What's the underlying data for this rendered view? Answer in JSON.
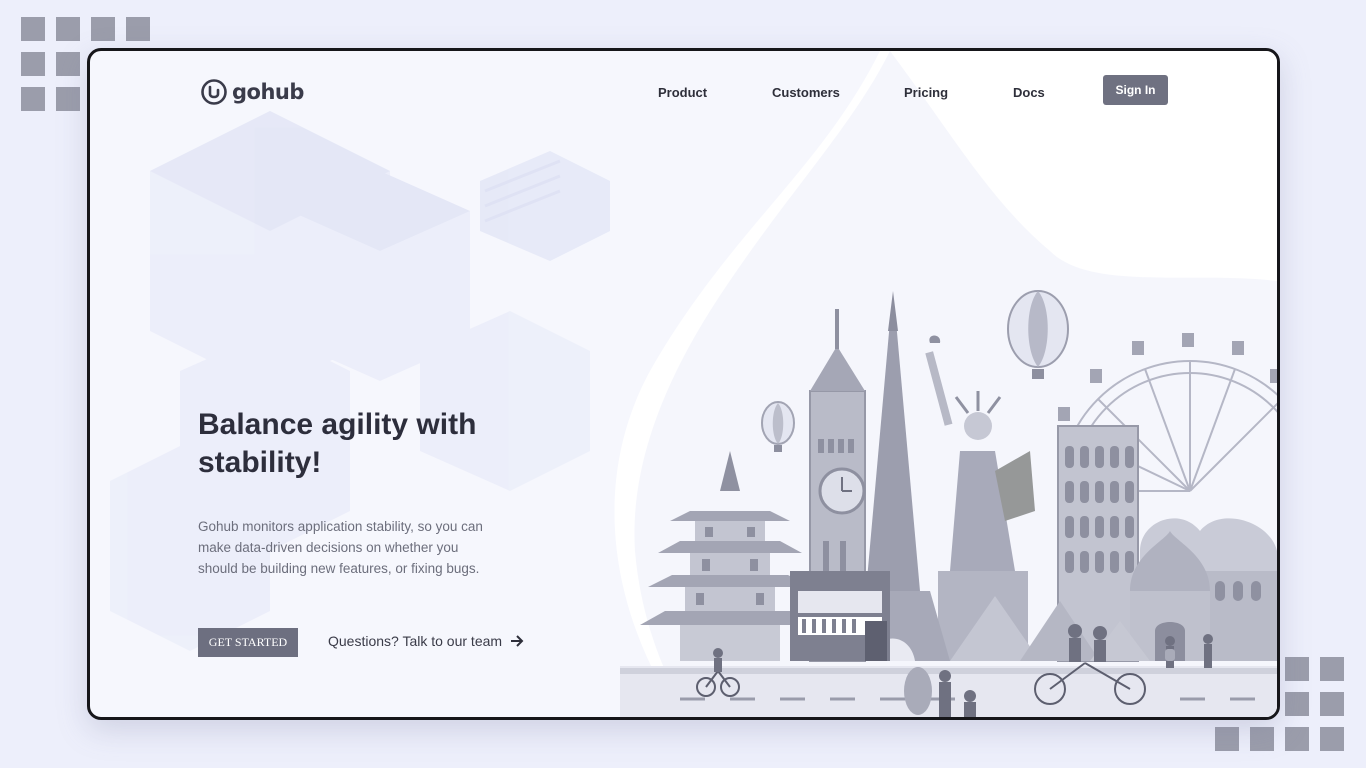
{
  "brand": {
    "name": "gohub"
  },
  "nav": {
    "items": [
      {
        "label": "Product"
      },
      {
        "label": "Customers"
      },
      {
        "label": "Pricing"
      },
      {
        "label": "Docs"
      }
    ],
    "signin_label": "Sign In"
  },
  "hero": {
    "title": "Balance agility with stability!",
    "description": "Gohub monitors application stability, so you can make data-driven decisions on whether you should be building new features, or fixing bugs.",
    "cta_label": "GET STARTED",
    "secondary_label": "Questions? Talk to our team",
    "secondary_icon": "arrow-right-icon",
    "illustration": "world-landmarks-illustration"
  },
  "colors": {
    "page_background": "#edeffb",
    "frame_border": "#16161a",
    "button": "#6f7181",
    "heading": "#2d2e3c",
    "body_text": "#6c6e7c",
    "deco_squares": "#9b9dab"
  }
}
